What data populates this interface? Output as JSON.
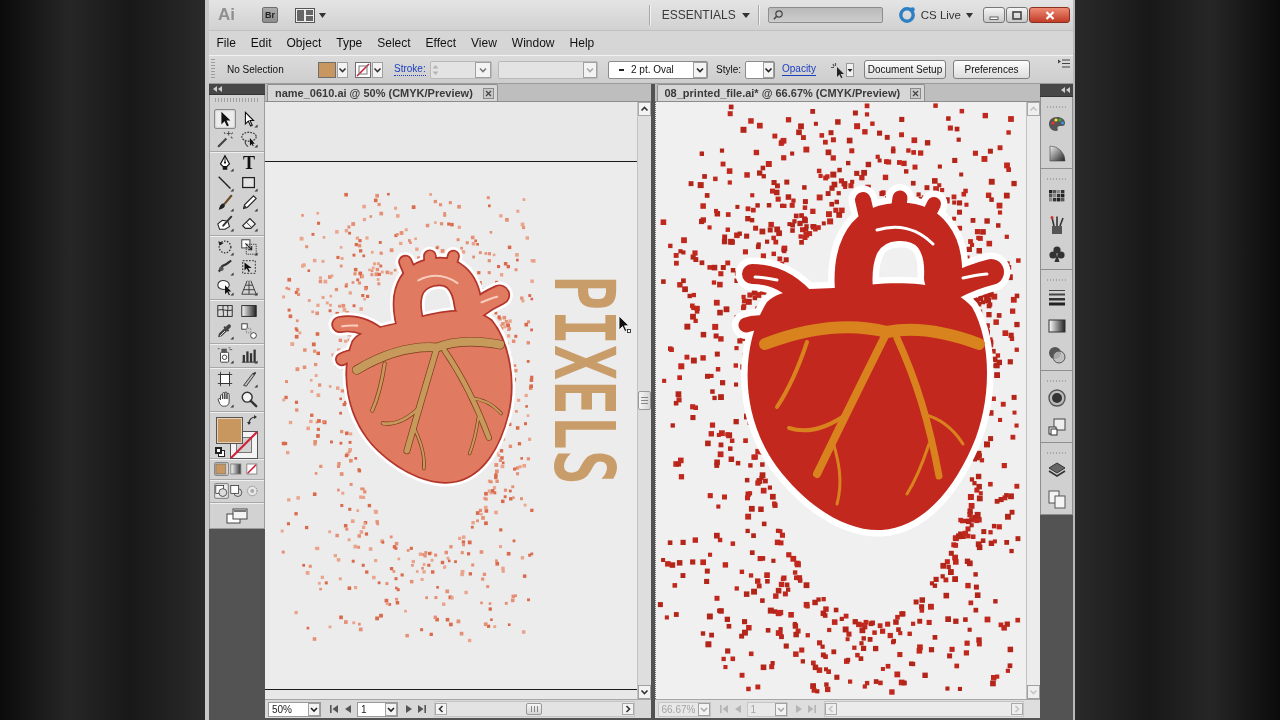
{
  "app_bar": {
    "logo": "Ai",
    "bridge_button": "Br",
    "workspace": "ESSENTIALS",
    "cs_live": "CS Live"
  },
  "menu_bar": [
    "File",
    "Edit",
    "Object",
    "Type",
    "Select",
    "Effect",
    "View",
    "Window",
    "Help"
  ],
  "control_bar": {
    "selection": "No Selection",
    "stroke_label": "Stroke:",
    "stroke_field": {
      "disabled": true
    },
    "blank_dropdown": {
      "disabled": true
    },
    "brush": "2 pt. Oval",
    "style_label": "Style:",
    "opacity_label": "Opacity",
    "buttons": [
      "Document Setup",
      "Preferences"
    ]
  },
  "toolbox": {
    "tool_groups": [
      [
        {
          "kind": "selection",
          "selected": true
        },
        {
          "kind": "direct-selection",
          "selected": false
        },
        {
          "kind": "magic-wand",
          "selected": false
        },
        {
          "kind": "lasso",
          "selected": false
        }
      ],
      [
        {
          "kind": "pen",
          "selected": false
        },
        {
          "kind": "type",
          "glyph": "T",
          "selected": false
        },
        {
          "kind": "line",
          "selected": false
        },
        {
          "kind": "rectangle",
          "selected": false
        },
        {
          "kind": "paintbrush",
          "selected": false
        },
        {
          "kind": "pencil",
          "selected": false
        },
        {
          "kind": "blob-brush",
          "selected": false
        },
        {
          "kind": "eraser",
          "selected": false
        }
      ],
      [
        {
          "kind": "rotate",
          "selected": false
        },
        {
          "kind": "scale",
          "selected": false
        },
        {
          "kind": "warp",
          "selected": false
        },
        {
          "kind": "free-transform",
          "selected": false
        },
        {
          "kind": "shape-builder",
          "selected": false
        },
        {
          "kind": "perspective-grid",
          "selected": false
        }
      ],
      [
        {
          "kind": "mesh",
          "selected": false
        },
        {
          "kind": "gradient",
          "selected": false
        },
        {
          "kind": "eyedropper",
          "selected": false
        },
        {
          "kind": "blend",
          "selected": false
        }
      ],
      [
        {
          "kind": "symbol-sprayer",
          "selected": false
        },
        {
          "kind": "column-graph",
          "selected": false
        }
      ],
      [
        {
          "kind": "artboard",
          "selected": false
        },
        {
          "kind": "slice",
          "selected": false
        },
        {
          "kind": "hand",
          "selected": false
        },
        {
          "kind": "zoom",
          "selected": false
        }
      ]
    ],
    "color_modes": [
      {
        "kind": "color",
        "selected": true
      },
      {
        "kind": "gradient",
        "selected": false
      },
      {
        "kind": "none",
        "selected": false
      }
    ],
    "draw_modes": [
      {
        "kind": "normal",
        "selected": true
      },
      {
        "kind": "behind",
        "selected": false
      },
      {
        "kind": "inside",
        "selected": false
      }
    ]
  },
  "documents": [
    {
      "title": "name_0610.ai @ 50% (CMYK/Preview)",
      "active": true,
      "zoom": "50%",
      "page": "1",
      "artwork_text": "PIXELS"
    },
    {
      "title": "08_printed_file.ai* @ 66.67% (CMYK/Preview)",
      "active": false,
      "zoom": "66.67%",
      "page": "1"
    }
  ]
}
